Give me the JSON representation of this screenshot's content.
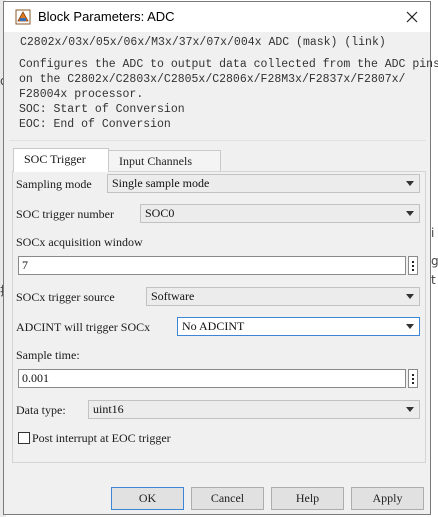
{
  "window": {
    "title": "Block Parameters: ADC"
  },
  "description": {
    "header": "C2802x/03x/05x/06x/M3x/37x/07x/004x ADC (mask) (link)",
    "lines": [
      "Configures the ADC to output data collected from the ADC pins",
      "on the C2802x/C2803x/C2805x/C2806x/F28M3x/F2837x/F2807x/",
      "F28004x processor.",
      "SOC: Start of Conversion",
      "EOC: End of Conversion"
    ]
  },
  "tabs": [
    {
      "label": "SOC Trigger",
      "active": true
    },
    {
      "label": "Input Channels",
      "active": false
    }
  ],
  "params": {
    "sampling_mode": {
      "label": "Sampling mode",
      "value": "Single sample mode"
    },
    "soc_trigger_number": {
      "label": "SOC trigger number",
      "value": "SOC0"
    },
    "socx_acq_window": {
      "label": "SOCx acquisition window",
      "value": "7"
    },
    "socx_trigger_source": {
      "label": "SOCx trigger source",
      "value": "Software"
    },
    "adcint_trigger": {
      "label": "ADCINT will trigger SOCx",
      "value": "No ADCINT"
    },
    "sample_time": {
      "label": "Sample time:",
      "value": "0.001"
    },
    "data_type": {
      "label": "Data type:",
      "value": "uint16"
    },
    "post_interrupt": {
      "label": "Post interrupt at EOC trigger",
      "checked": false
    }
  },
  "buttons": {
    "ok": "OK",
    "cancel": "Cancel",
    "help": "Help",
    "apply": "Apply"
  },
  "background": {
    "right_glyphs": [
      "i",
      "g",
      "t"
    ],
    "left_glyph": "换",
    "left_glyph_top": "o"
  },
  "colors": {
    "focus": "#3c86d6",
    "dialog_bg": "#f0f0f0"
  }
}
